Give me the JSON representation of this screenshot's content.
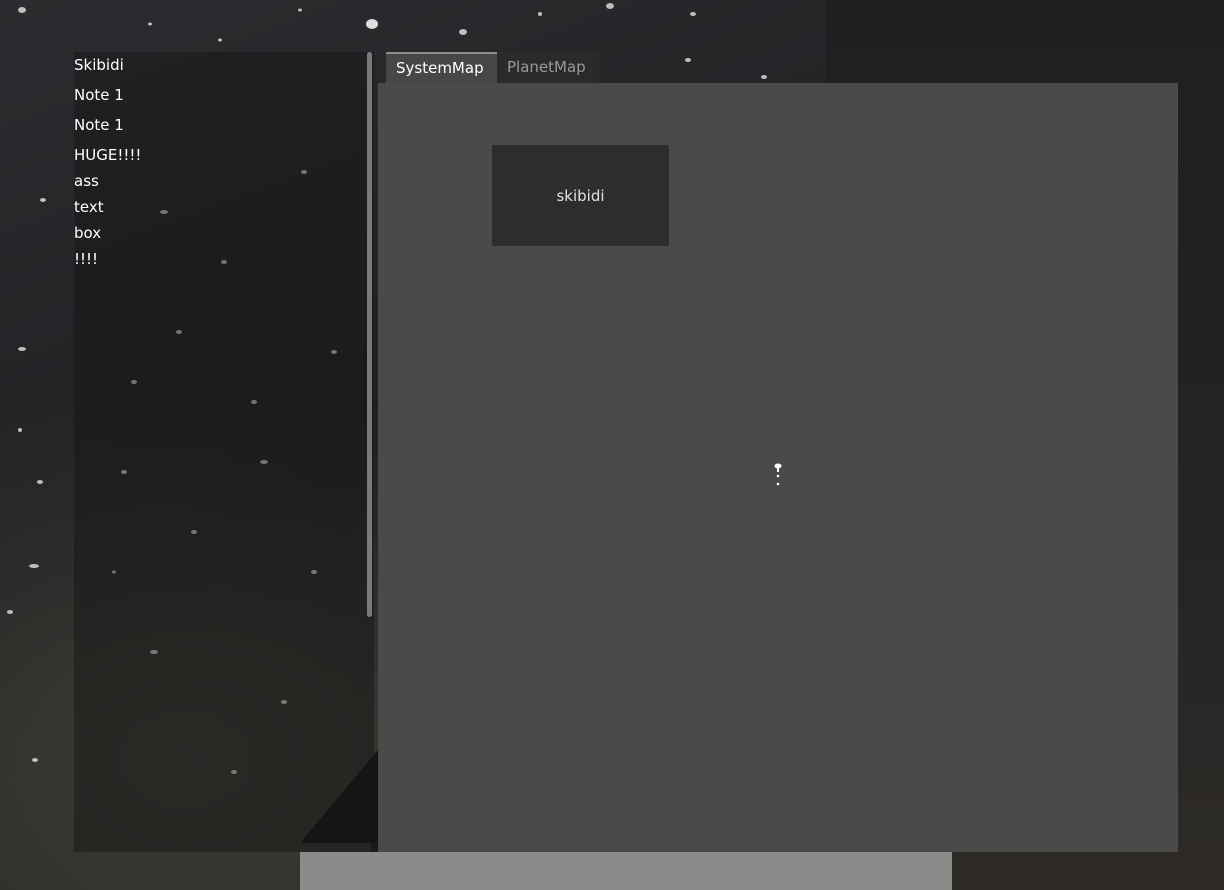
{
  "notes": {
    "lines": [
      "Skibidi",
      "Note 1",
      "Note 1",
      "HUGE!!!!",
      "ass",
      "text",
      "box",
      "!!!!"
    ]
  },
  "tabs": [
    {
      "label": "SystemMap",
      "active": true
    },
    {
      "label": "PlanetMap",
      "active": false
    }
  ],
  "map": {
    "node_label": "skibidi"
  },
  "icons": {
    "cursor": "drag-cursor-icon",
    "corner": "resize-corner-icon"
  },
  "colors": {
    "map_background": "#4a4a4a",
    "node_background": "#2d2d2d",
    "tab_active": "#474747",
    "tab_inactive": "#2a2a2a",
    "bottom_bar": "#8b8b8b"
  }
}
